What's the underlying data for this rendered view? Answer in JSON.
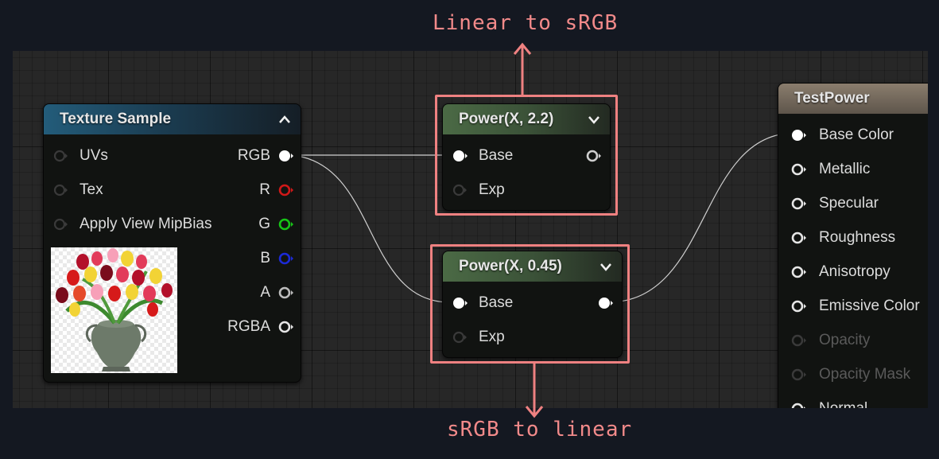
{
  "annotations": {
    "top": "Linear to sRGB",
    "bottom": "sRGB to linear",
    "color": "#ef8181"
  },
  "texture_node": {
    "title": "Texture Sample",
    "collapse_icon": "chevron-up-icon",
    "inputs": [
      "UVs",
      "Tex",
      "Apply View MipBias"
    ],
    "outputs": [
      {
        "label": "RGB",
        "color": "#ffffff"
      },
      {
        "label": "R",
        "color": "#d01818"
      },
      {
        "label": "G",
        "color": "#17c617"
      },
      {
        "label": "B",
        "color": "#1c2ad6"
      },
      {
        "label": "A",
        "color": "#bdbdbd"
      },
      {
        "label": "RGBA",
        "color": "#e6e6e6"
      }
    ],
    "thumbnail_icon": "tulip-vase-texture"
  },
  "power_top": {
    "title": "Power(X, 2.2)",
    "collapse_icon": "chevron-down-icon",
    "inputs": [
      "Base",
      "Exp"
    ]
  },
  "power_bottom": {
    "title": "Power(X, 0.45)",
    "collapse_icon": "chevron-down-icon",
    "inputs": [
      "Base",
      "Exp"
    ]
  },
  "result_node": {
    "title": "TestPower",
    "inputs": [
      {
        "label": "Base Color",
        "enabled": true
      },
      {
        "label": "Metallic",
        "enabled": true
      },
      {
        "label": "Specular",
        "enabled": true
      },
      {
        "label": "Roughness",
        "enabled": true
      },
      {
        "label": "Anisotropy",
        "enabled": true
      },
      {
        "label": "Emissive Color",
        "enabled": true
      },
      {
        "label": "Opacity",
        "enabled": false
      },
      {
        "label": "Opacity Mask",
        "enabled": false
      },
      {
        "label": "Normal",
        "enabled": true
      }
    ]
  }
}
